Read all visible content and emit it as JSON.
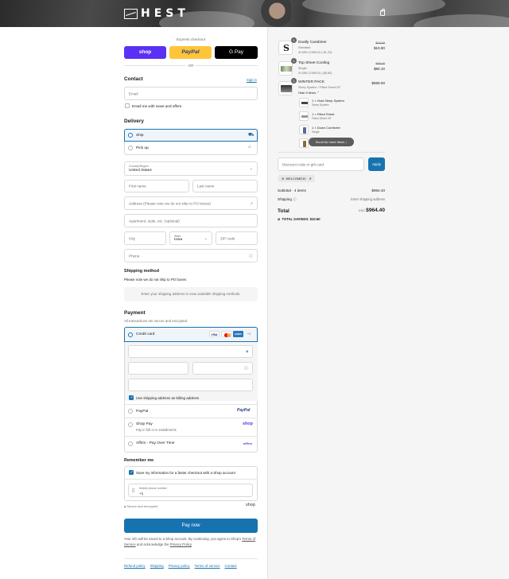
{
  "brand": {
    "name": "HEST"
  },
  "express": {
    "title": "Express checkout",
    "shop_label": "shop",
    "paypal_label": "PayPal",
    "gpay_label": "G Pay",
    "or_label": "OR"
  },
  "contact": {
    "heading": "Contact",
    "signin_label": "Sign in",
    "email_placeholder": "Email",
    "news_label": "Email me with news and offers"
  },
  "delivery": {
    "heading": "Delivery",
    "ship_label": "Ship",
    "pickup_label": "Pick up",
    "country_label": "Country/Region",
    "country_value": "United States",
    "first_name_placeholder": "First name",
    "last_name_placeholder": "Last name",
    "address_placeholder": "Address (Please note we do not ship to PO boxes)",
    "apartment_placeholder": "Apartment, suite, etc. (optional)",
    "city_placeholder": "City",
    "state_label": "State",
    "state_value": "Iowa",
    "zip_placeholder": "ZIP code",
    "phone_placeholder": "Phone"
  },
  "shipping_method": {
    "heading": "Shipping method",
    "note": "Please note we do not ship to PO boxes",
    "placeholder": "Enter your shipping address to view available shipping methods."
  },
  "payment": {
    "heading": "Payment",
    "subtitle": "All transactions are secure and encrypted.",
    "credit_card_label": "Credit card",
    "card_brands": [
      "VISA",
      "MC",
      "AMEX",
      "+4"
    ],
    "billing_same_label": "Use shipping address as billing address",
    "paypal_label": "PayPal",
    "paypal_brand": "PayPal",
    "shop_pay_label": "Shop Pay",
    "shop_pay_sub": "Pay in full or in installments",
    "shop_pay_brand": "shop",
    "affirm_label": "Affirm - Pay Over Time",
    "affirm_brand": "affirm"
  },
  "remember": {
    "heading": "Remember me",
    "save_label": "Save my information for a faster checkout with a Shop account",
    "mobile_label": "Mobile phone number",
    "mobile_value": "+1",
    "secure_label": "Secure and encrypted",
    "shop_brand": "shop"
  },
  "pay_button": "Pay now",
  "legal": {
    "text_before": "Your info will be saved to a Shop account. By continuing, you agree to Shop's",
    "terms_link": "Terms of Service",
    "text_mid": "and acknowledge the",
    "privacy_link": "Privacy Policy",
    "text_end": "."
  },
  "footer_links": [
    "Refund policy",
    "Shipping",
    "Privacy policy",
    "Terms of service",
    "Contact"
  ],
  "order": {
    "items": [
      {
        "qty": "1",
        "name": "Dually Carabiner",
        "variant": "Standard",
        "discount": "WELCOME10 (-$1.20)",
        "original": "$12.00",
        "price": "$10.80"
      },
      {
        "qty": "1",
        "name": "Top Sheet Cooling",
        "variant": "Single",
        "discount": "WELCOME10 (-$8.80)",
        "original": "$88.00",
        "price": "$80.10"
      },
      {
        "qty": "1",
        "name": "WINTER PACK",
        "variant": "Sleep System / Fitted Sheet 20\"",
        "hide_label": "Hide 5 items",
        "price": "$869.00"
      }
    ],
    "bundle": [
      {
        "name": "1 × Host Sleep System",
        "variant": "Sleep System"
      },
      {
        "name": "1 × Fitted Sheet",
        "variant": "Fitted Sheet 20\""
      },
      {
        "name": "1 × Down Comforter",
        "variant": "Single"
      }
    ],
    "scroll_hint": "Scroll for more items",
    "discount_placeholder": "Discount code or gift card",
    "apply_label": "Apply",
    "applied_code": "WELCOME10",
    "subtotal_label": "Subtotal · 4 items",
    "subtotal_value": "$964.40",
    "shipping_label": "Shipping",
    "shipping_value": "Enter shipping address",
    "total_label": "Total",
    "currency": "USD",
    "total_value": "$964.40",
    "savings_label": "TOTAL SAVINGS",
    "savings_value": "$10.60"
  },
  "colors": {
    "primary": "#1773b0",
    "shop": "#5a31f4",
    "paypal": "#ffc439",
    "gpay": "#000000"
  }
}
